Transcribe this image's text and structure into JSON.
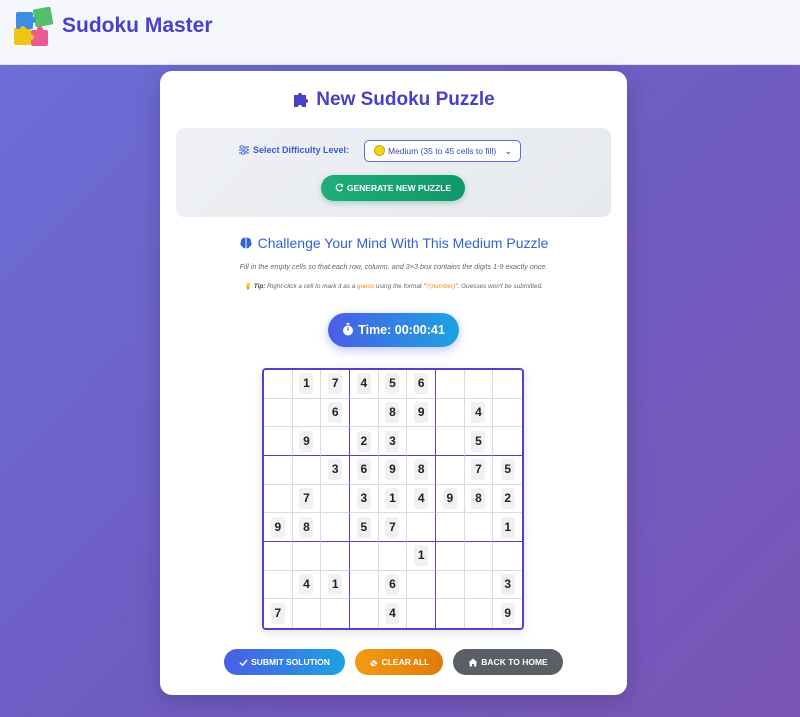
{
  "header": {
    "brand": "Sudoku Master",
    "logo_icon": "puzzle-pieces-icon"
  },
  "main": {
    "title": "New Sudoku Puzzle",
    "title_icon": "puzzle-piece-icon",
    "difficulty": {
      "label": "Select Difficulty Level:",
      "label_icon": "sliders-icon",
      "selected": "Medium (35 to 45 cells to fill)",
      "selected_icon": "yellow-circle-icon",
      "generate_button": "GENERATE NEW PUZZLE",
      "generate_icon": "refresh-icon"
    },
    "challenge": {
      "heading": "Challenge Your Mind With This Medium Puzzle",
      "heading_icon": "brain-icon",
      "instructions": "Fill in the empty cells so that each row, column, and 3×3 box contains the digits 1-9 exactly once.",
      "tip_label": "Tip:",
      "tip_before": " Right-click a cell to mark it as a ",
      "tip_guess": "guess",
      "tip_middle": " using the format \"",
      "tip_format": "?(number)",
      "tip_after": "\". Guesses won't be submitted.",
      "tip_icon": "lightbulb-icon"
    },
    "timer": {
      "label": "Time: 00:00:41",
      "icon": "stopwatch-icon"
    },
    "board": [
      [
        "",
        "1",
        "7",
        "4",
        "5",
        "6",
        "",
        "",
        ""
      ],
      [
        "",
        "",
        "6",
        "",
        "8",
        "9",
        "",
        "4",
        ""
      ],
      [
        "",
        "9",
        "",
        "2",
        "3",
        "",
        "",
        "5",
        ""
      ],
      [
        "",
        "",
        "3",
        "6",
        "9",
        "8",
        "",
        "7",
        "5"
      ],
      [
        "",
        "7",
        "",
        "3",
        "1",
        "4",
        "9",
        "8",
        "2"
      ],
      [
        "9",
        "8",
        "",
        "5",
        "7",
        "",
        "",
        "",
        "1"
      ],
      [
        "",
        "",
        "",
        "",
        "",
        "1",
        "",
        "",
        ""
      ],
      [
        "",
        "4",
        "1",
        "",
        "6",
        "",
        "",
        "",
        "3"
      ],
      [
        "7",
        "",
        "",
        "",
        "4",
        "",
        "",
        "",
        "9"
      ]
    ],
    "actions": {
      "submit": "SUBMIT SOLUTION",
      "submit_icon": "check-icon",
      "clear": "CLEAR ALL",
      "clear_icon": "eraser-icon",
      "home": "BACK TO HOME",
      "home_icon": "home-icon"
    }
  },
  "colors": {
    "brand": "#4a3fc8",
    "generate": "#12966a",
    "submit": "#4a5ee6",
    "clear": "#f29b12",
    "home": "#5a5f66",
    "grid_border": "#4e44c4"
  }
}
